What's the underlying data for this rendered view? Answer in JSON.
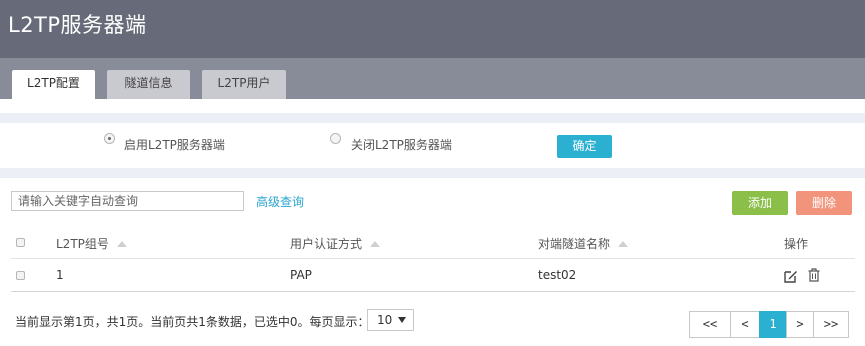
{
  "header": {
    "title": "L2TP服务器端"
  },
  "tabs": [
    {
      "label": "L2TP配置",
      "active": true
    },
    {
      "label": "隧道信息",
      "active": false
    },
    {
      "label": "L2TP用户",
      "active": false
    }
  ],
  "server_mode": {
    "enable_label": "启用L2TP服务器端",
    "disable_label": "关闭L2TP服务器端",
    "selected": "enable",
    "confirm_label": "确定"
  },
  "toolbar": {
    "search_placeholder": "请输入关键字自动查询",
    "advanced_search_label": "高级查询",
    "add_label": "添加",
    "delete_label": "删除"
  },
  "table": {
    "columns": [
      "L2TP组号",
      "用户认证方式",
      "对端隧道名称",
      "操作"
    ],
    "rows": [
      {
        "group": "1",
        "auth": "PAP",
        "peer": "test02"
      }
    ]
  },
  "footer": {
    "status_text": "当前显示第1页，共1页。当前页共1条数据，已选中0。每页显示：",
    "page_size": "10"
  },
  "pagination": {
    "first": "<<",
    "prev": "<",
    "current": "1",
    "next": ">",
    "last": ">>"
  },
  "colors": {
    "header_bg": "#666a79",
    "tabbar_bg": "#888b98",
    "accent": "#2bb0d2",
    "add_button": "#8bbf4a",
    "delete_button": "#f2937c",
    "link": "#2aa6cf"
  },
  "icons": {
    "edit": "edit-icon",
    "delete": "trash-icon",
    "sort": "sort-up-icon"
  }
}
